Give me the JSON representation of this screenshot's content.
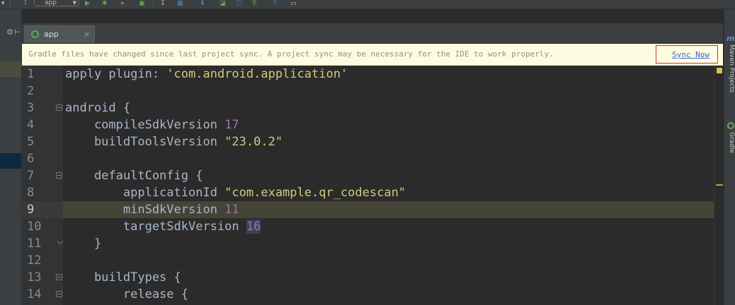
{
  "toolbar": {
    "run_config": "app",
    "icons": [
      "run-icon",
      "debug-icon",
      "attach-debugger-icon",
      "avd-manager-icon",
      "sdk-manager-icon",
      "sync-icon",
      "structure-icon",
      "help-icon"
    ]
  },
  "tabs": [
    {
      "label": "app",
      "icon": "gradle-icon"
    }
  ],
  "notice": {
    "message": "Gradle files have changed since last project sync. A project sync may be necessary for the IDE to work properly.",
    "action": "Sync Now"
  },
  "editor": {
    "current_line": 9,
    "lines": [
      {
        "n": "1",
        "parts": [
          [
            "p",
            "apply plugin: "
          ],
          [
            "s",
            "'com.android.application'"
          ]
        ]
      },
      {
        "n": "2",
        "parts": []
      },
      {
        "n": "3",
        "parts": [
          [
            "p",
            "android {"
          ]
        ]
      },
      {
        "n": "4",
        "parts": [
          [
            "p",
            "    compileSdkVersion "
          ],
          [
            "n",
            "17"
          ]
        ]
      },
      {
        "n": "5",
        "parts": [
          [
            "p",
            "    buildToolsVersion "
          ],
          [
            "s",
            "\"23.0.2\""
          ]
        ]
      },
      {
        "n": "6",
        "parts": []
      },
      {
        "n": "7",
        "parts": [
          [
            "p",
            "    defaultConfig {"
          ]
        ]
      },
      {
        "n": "8",
        "parts": [
          [
            "p",
            "        applicationId "
          ],
          [
            "s",
            "\"com.example.qr_codescan\""
          ]
        ]
      },
      {
        "n": "9",
        "parts": [
          [
            "p",
            "        minSdkVersion "
          ],
          [
            "n",
            "11"
          ]
        ]
      },
      {
        "n": "10",
        "parts": [
          [
            "p",
            "        targetSdkVersion "
          ],
          [
            "h",
            "16"
          ]
        ]
      },
      {
        "n": "11",
        "parts": [
          [
            "p",
            "    }"
          ]
        ]
      },
      {
        "n": "12",
        "parts": []
      },
      {
        "n": "13",
        "parts": [
          [
            "p",
            "    buildTypes {"
          ]
        ]
      },
      {
        "n": "14",
        "parts": [
          [
            "p",
            "        release {"
          ]
        ]
      }
    ]
  },
  "right_tools": {
    "maven": "Maven Projects",
    "gradle": "Gradle"
  },
  "colors": {
    "editor_bg": "#2b2b2b",
    "notice_bg": "#fefce0",
    "string": "#d4c97a",
    "number": "#9876aa",
    "link": "#3c64d8",
    "highlight_box": "#cc3333"
  }
}
